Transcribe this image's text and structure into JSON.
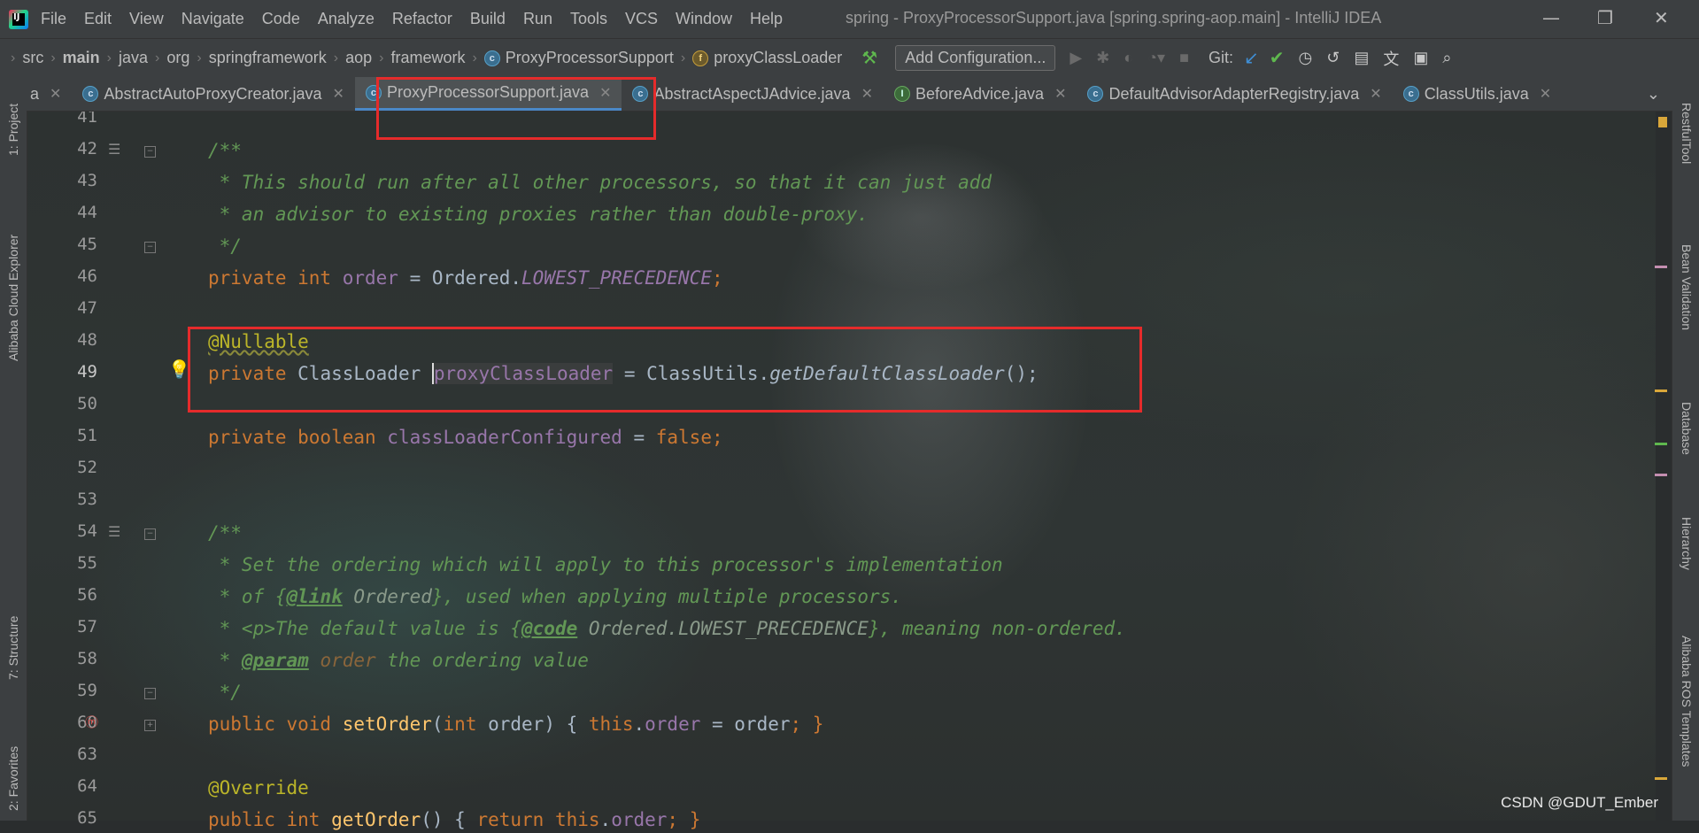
{
  "window": {
    "title": "spring - ProxyProcessorSupport.java [spring.spring-aop.main] - IntelliJ IDEA",
    "menu": [
      "File",
      "Edit",
      "View",
      "Navigate",
      "Code",
      "Analyze",
      "Refactor",
      "Build",
      "Run",
      "Tools",
      "VCS",
      "Window",
      "Help"
    ]
  },
  "breadcrumbs": [
    "src",
    "main",
    "java",
    "org",
    "springframework",
    "aop",
    "framework",
    "ProxyProcessorSupport",
    "proxyClassLoader"
  ],
  "toolbar": {
    "add_configuration": "Add Configuration...",
    "git_label": "Git:"
  },
  "tabs": [
    {
      "label": "a",
      "icon": "class-icon"
    },
    {
      "label": "AbstractAutoProxyCreator.java",
      "icon": "class-icon"
    },
    {
      "label": "ProxyProcessorSupport.java",
      "icon": "class-icon",
      "active": true
    },
    {
      "label": "AbstractAspectJAdvice.java",
      "icon": "class-icon"
    },
    {
      "label": "BeforeAdvice.java",
      "icon": "interface-icon"
    },
    {
      "label": "DefaultAdvisorAdapterRegistry.java",
      "icon": "class-icon"
    },
    {
      "label": "ClassUtils.java",
      "icon": "class-icon"
    }
  ],
  "left_tools": [
    "1: Project",
    "Alibaba Cloud Explorer",
    "7: Structure",
    "2: Favorites"
  ],
  "right_tools": [
    "RestfulTool",
    "Bean Validation",
    "Database",
    "Hierarchy",
    "Alibaba ROS Templates"
  ],
  "line_numbers": [
    "41",
    "42",
    "43",
    "44",
    "45",
    "46",
    "47",
    "48",
    "49",
    "50",
    "51",
    "52",
    "53",
    "54",
    "55",
    "56",
    "57",
    "58",
    "59",
    "60",
    "63",
    "64",
    "65"
  ],
  "code": {
    "l42": "/**",
    "l43": " * This should run after all other processors, so that it can just add",
    "l44": " * an advisor to existing proxies rather than double-proxy.",
    "l45": " */",
    "l46_kw": "private int ",
    "l46_field": "order",
    "l46_mid": " = Ordered.",
    "l46_const": "LOWEST_PRECEDENCE",
    "l46_end": ";",
    "l48": "@Nullable",
    "l49_kw": "private ",
    "l49_type": "ClassLoader ",
    "l49_field": "proxyClassLoader",
    "l49_mid": " = ClassUtils.",
    "l49_meth": "getDefaultClassLoader",
    "l49_end": "();",
    "l51_kw": "private boolean ",
    "l51_field": "classLoaderConfigured",
    "l51_mid": " = ",
    "l51_val": "false",
    "l51_end": ";",
    "l54": "/**",
    "l55": " * Set the ordering which will apply to this processor's implementation",
    "l56_a": " * of {",
    "l56_tag": "@link",
    "l56_b": " Ordered",
    "l56_c": "}, used when applying multiple processors.",
    "l57_a": " * <p>",
    "l57_b": "The default value is {",
    "l57_tag": "@code",
    "l57_c": " Ordered.LOWEST_PRECEDENCE",
    "l57_d": "}, meaning non-ordered.",
    "l58_a": " * ",
    "l58_tag": "@param",
    "l58_b": " order",
    "l58_c": " the ordering value",
    "l59": " */",
    "l60_kw": "public void ",
    "l60_meth": "setOrder",
    "l60_a": "(",
    "l60_kw2": "int ",
    "l60_b": "order) { ",
    "l60_this": "this",
    "l60_c": ".",
    "l60_field": "order",
    "l60_d": " = order",
    "l60_e": "; }",
    "l64": "@Override",
    "l65_kw": "public int ",
    "l65_meth": "getOrder",
    "l65_a": "() { ",
    "l65_kw2": "return this",
    "l65_b": ".",
    "l65_field": "order",
    "l65_c": "; }"
  },
  "watermark": "CSDN @GDUT_Ember"
}
